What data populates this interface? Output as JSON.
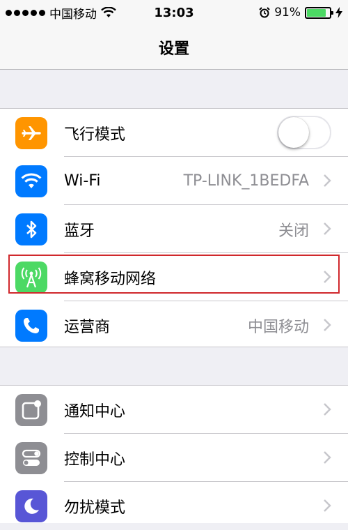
{
  "status_bar": {
    "carrier": "中国移动",
    "time": "13:03",
    "battery_percent": "91%",
    "battery_level": 0.91,
    "icons": [
      "signal-dots-icon",
      "wifi-icon",
      "alarm-icon",
      "battery-icon",
      "charging-bolt-icon"
    ]
  },
  "nav": {
    "title": "设置"
  },
  "group1": [
    {
      "label": "飞行模式",
      "icon": "airplane-icon",
      "color": "#ff9500",
      "toggle_on": false
    },
    {
      "label": "Wi-Fi",
      "value": "TP-LINK_1BEDFA",
      "icon": "wifi-icon",
      "color": "#007aff"
    },
    {
      "label": "蓝牙",
      "value": "关闭",
      "icon": "bluetooth-icon",
      "color": "#007aff"
    },
    {
      "label": "蜂窝移动网络",
      "icon": "cellular-antenna-icon",
      "color": "#4cd964"
    },
    {
      "label": "运营商",
      "value": "中国移动",
      "icon": "phone-icon",
      "color": "#007aff"
    }
  ],
  "group2": [
    {
      "label": "通知中心",
      "icon": "notification-center-icon",
      "color": "#8e8e93"
    },
    {
      "label": "控制中心",
      "icon": "control-center-icon",
      "color": "#8e8e93"
    },
    {
      "label": "勿扰模式",
      "icon": "moon-icon",
      "color": "#5856d6"
    }
  ],
  "colors": {
    "highlight": "#d0282c",
    "toggle_off_border": "#e5e5ea"
  }
}
